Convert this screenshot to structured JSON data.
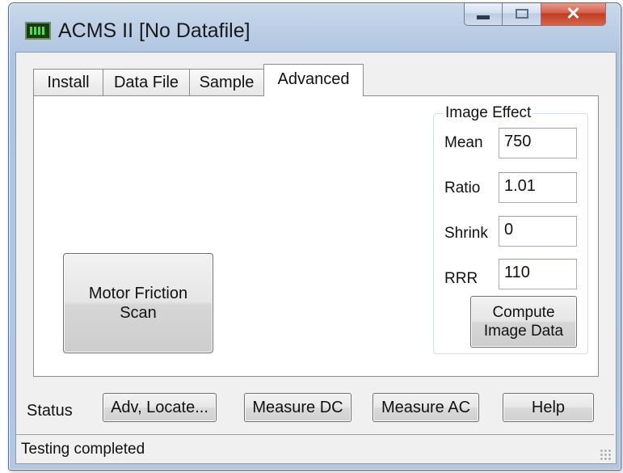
{
  "window": {
    "title": "ACMS II [No Datafile]",
    "app_icon": "acms-app-icon",
    "close_glyph": "✕",
    "accent_close": "#c23b22"
  },
  "tabs": [
    {
      "label": "Install",
      "active": false
    },
    {
      "label": "Data File",
      "active": false
    },
    {
      "label": "Sample",
      "active": false
    },
    {
      "label": "Advanced",
      "active": true
    }
  ],
  "advanced": {
    "motor_button": "Motor Friction\nScan",
    "image_effect": {
      "legend": "Image Effect",
      "fields": [
        {
          "label": "Mean",
          "value": "750"
        },
        {
          "label": "Ratio",
          "value": "1.01"
        },
        {
          "label": "Shrink",
          "value": "0"
        },
        {
          "label": "RRR",
          "value": "110"
        }
      ],
      "compute_button": "Compute\nImage Data"
    }
  },
  "bottom": {
    "status_label": "Status",
    "buttons": [
      "Adv, Locate...",
      "Measure DC",
      "Measure AC",
      "Help"
    ]
  },
  "statusbar": {
    "text": "Testing completed"
  }
}
